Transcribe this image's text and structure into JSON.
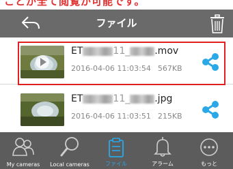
{
  "caption": "ことが全て閲覧が可能です。",
  "header": {
    "title": "ファイル"
  },
  "files": [
    {
      "name_prefix": "ET",
      "name_suffix": ".mov",
      "datetime": "2016-04-06 11:03:54",
      "size": "567KB",
      "type": "video"
    },
    {
      "name_prefix": "ET",
      "name_suffix": ".jpg",
      "datetime": "2016-04-06 11:03:51",
      "size": "215KB",
      "type": "image"
    }
  ],
  "tabs": [
    {
      "label": "My cameras",
      "icon": "cameras-icon",
      "active": false
    },
    {
      "label": "Local cameras",
      "icon": "search-icon",
      "active": false
    },
    {
      "label": "ファイル",
      "icon": "clipboard-icon",
      "active": true
    },
    {
      "label": "アラーム",
      "icon": "bell-icon",
      "active": false
    },
    {
      "label": "もっと",
      "icon": "more-icon",
      "active": false
    }
  ],
  "colors": {
    "accent": "#2aa8e8",
    "highlight": "#e02020",
    "header_bg": "#6a6a6a",
    "tabbar_bg": "#5c5c5c"
  }
}
